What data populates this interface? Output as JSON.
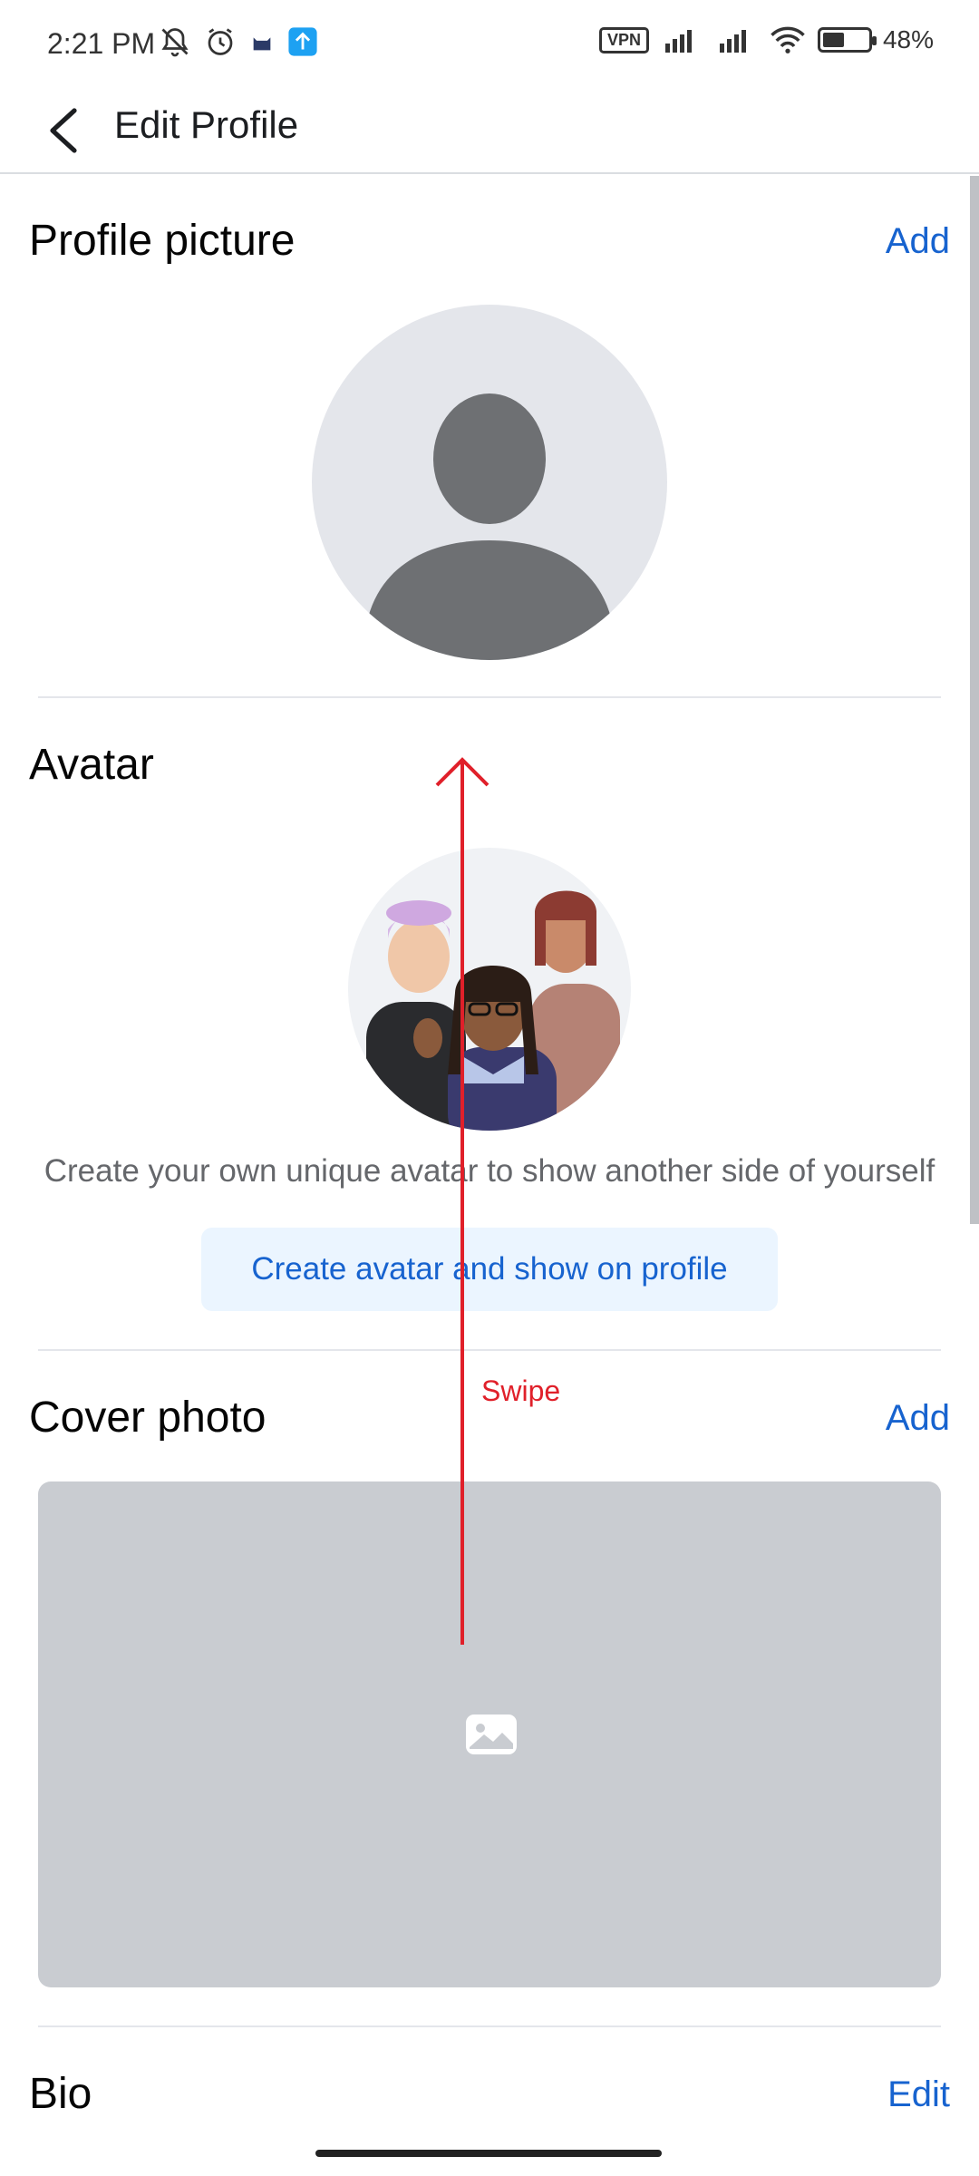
{
  "status_bar": {
    "time": "2:21 PM",
    "vpn": "VPN",
    "battery_text": "48%",
    "battery_level": 0.48,
    "icons": [
      "bell-off-icon",
      "alarm-icon",
      "cat-icon",
      "upload-icon",
      "hd-signal-icon",
      "hd-signal-icon",
      "wifi-icon",
      "battery-icon"
    ]
  },
  "header": {
    "back_icon": "arrow-left-icon",
    "title": "Edit Profile"
  },
  "profile_picture": {
    "title": "Profile picture",
    "action": "Add"
  },
  "avatar": {
    "title": "Avatar",
    "description": "Create your own unique avatar to show another side of yourself",
    "button": "Create avatar and show on profile"
  },
  "cover_photo": {
    "title": "Cover photo",
    "action": "Add",
    "placeholder_icon": "image-icon"
  },
  "bio": {
    "title": "Bio",
    "action": "Edit"
  },
  "gesture_annotation": {
    "label": "Swipe",
    "color": "#e0202a"
  },
  "colors": {
    "accent": "#1763cf",
    "button_bg": "#ebf5ff",
    "placeholder_gray": "#c9ccd1"
  }
}
